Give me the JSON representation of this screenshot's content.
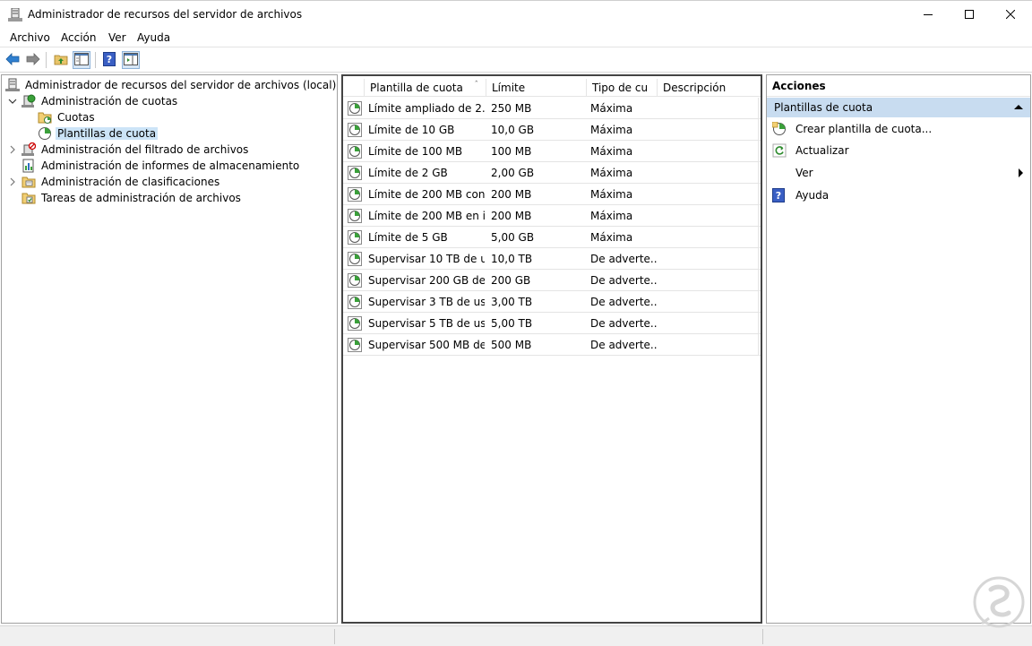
{
  "window": {
    "title": "Administrador de recursos del servidor de archivos",
    "minimize_icon": "minimize-icon",
    "maximize_icon": "maximize-icon",
    "close_icon": "close-icon"
  },
  "menu": {
    "items": [
      {
        "label": "Archivo"
      },
      {
        "label": "Acción"
      },
      {
        "label": "Ver"
      },
      {
        "label": "Ayuda"
      }
    ]
  },
  "toolbar": {
    "buttons": [
      "back-arrow-icon",
      "forward-arrow-icon",
      "up-folder-icon",
      "show-hide-tree-icon",
      "help-icon",
      "show-hide-action-pane-icon"
    ]
  },
  "tree": {
    "root": "Administrador de recursos del servidor de archivos (local)",
    "items": [
      {
        "label": "Administración de cuotas",
        "expanded": true
      },
      {
        "label": "Cuotas"
      },
      {
        "label": "Plantillas de cuota",
        "selected": true
      },
      {
        "label": "Administración del filtrado de archivos"
      },
      {
        "label": "Administración de informes de almacenamiento"
      },
      {
        "label": "Administración de clasificaciones"
      },
      {
        "label": "Tareas de administración de archivos"
      }
    ]
  },
  "list": {
    "columns": [
      {
        "label": "Plantilla de cuota"
      },
      {
        "label": "Límite"
      },
      {
        "label": "Tipo de cu"
      },
      {
        "label": "Descripción"
      }
    ],
    "rows": [
      {
        "name": "Límite ampliado de 2...",
        "limit": "250 MB",
        "type": "Máxima"
      },
      {
        "name": "Límite de 10 GB",
        "limit": "10,0 GB",
        "type": "Máxima"
      },
      {
        "name": "Límite de 100 MB",
        "limit": "100 MB",
        "type": "Máxima"
      },
      {
        "name": "Límite de 2 GB",
        "limit": "2,00 GB",
        "type": "Máxima"
      },
      {
        "name": "Límite de 200 MB con...",
        "limit": "200 MB",
        "type": "Máxima"
      },
      {
        "name": "Límite de 200 MB en i...",
        "limit": "200 MB",
        "type": "Máxima"
      },
      {
        "name": "Límite de 5 GB",
        "limit": "5,00 GB",
        "type": "Máxima"
      },
      {
        "name": "Supervisar 10 TB de u...",
        "limit": "10,0 TB",
        "type": "De adverte..."
      },
      {
        "name": "Supervisar 200 GB de ...",
        "limit": "200 GB",
        "type": "De adverte..."
      },
      {
        "name": "Supervisar 3 TB de us...",
        "limit": "3,00 TB",
        "type": "De adverte..."
      },
      {
        "name": "Supervisar 5 TB de us...",
        "limit": "5,00 TB",
        "type": "De adverte..."
      },
      {
        "name": "Supervisar 500 MB de ...",
        "limit": "500 MB",
        "type": "De adverte..."
      }
    ]
  },
  "actions": {
    "title": "Acciones",
    "group": "Plantillas de cuota",
    "items": [
      {
        "label": "Crear plantilla de cuota...",
        "icon": "new-template-icon"
      },
      {
        "label": "Actualizar",
        "icon": "refresh-icon"
      },
      {
        "label": "Ver",
        "icon": ""
      },
      {
        "label": "Ayuda",
        "icon": "help-icon"
      }
    ]
  },
  "colors": {
    "selection": "#cce4f7",
    "actions_group": "#c8dcf0"
  }
}
